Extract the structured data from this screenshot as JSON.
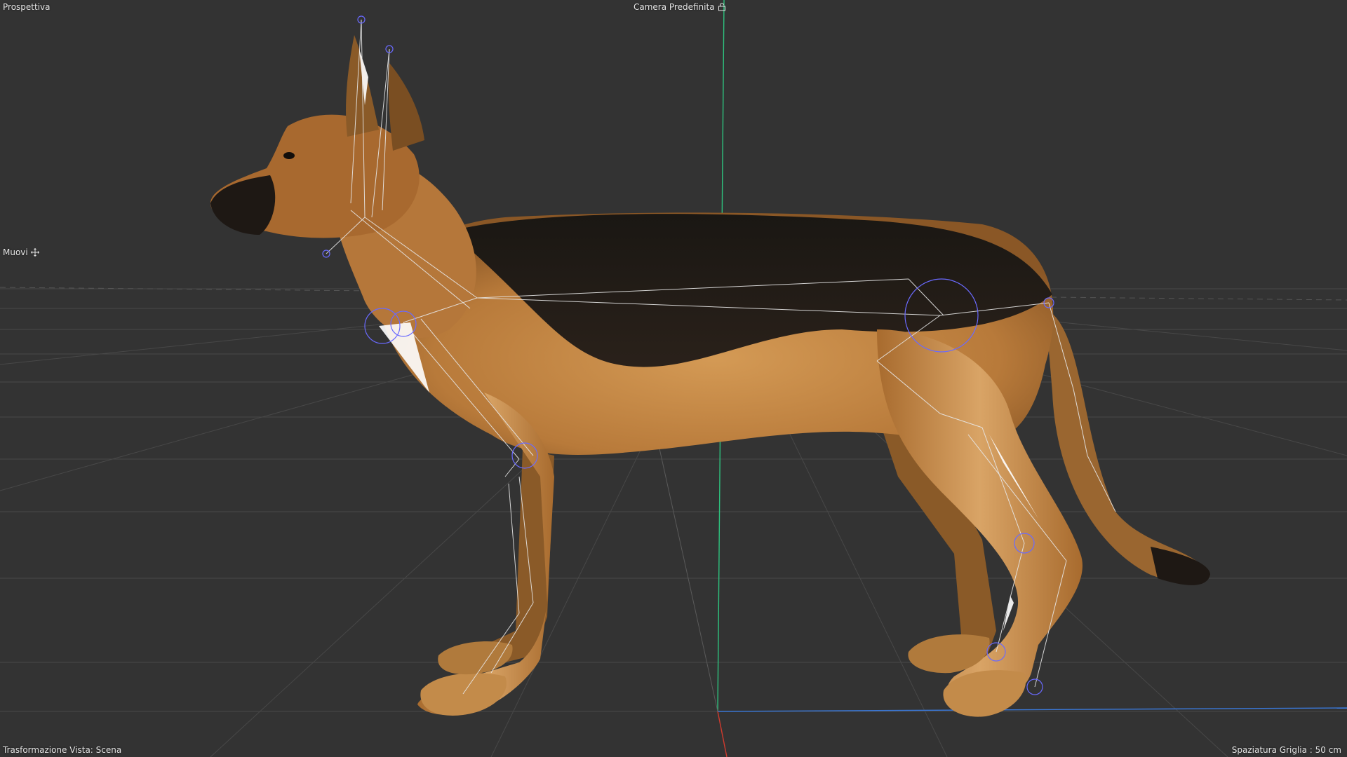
{
  "viewport": {
    "view_mode": "Prospettiva",
    "camera": "Camera Predefinita",
    "camera_icon": "camera-lock-icon",
    "tool": "Muovi",
    "tool_icon": "move-icon",
    "view_transform": "Trasformazione Vista: Scena",
    "grid_spacing": "Spaziatura Griglia : 50 cm"
  },
  "colors": {
    "background": "#333333",
    "grid": "#4a4a4a",
    "y_axis": "#2ec27e",
    "x_axis": "#d03a2e",
    "z_axis": "#3a78d8",
    "joint": "#6a6aff",
    "bone": "#ffffff"
  }
}
